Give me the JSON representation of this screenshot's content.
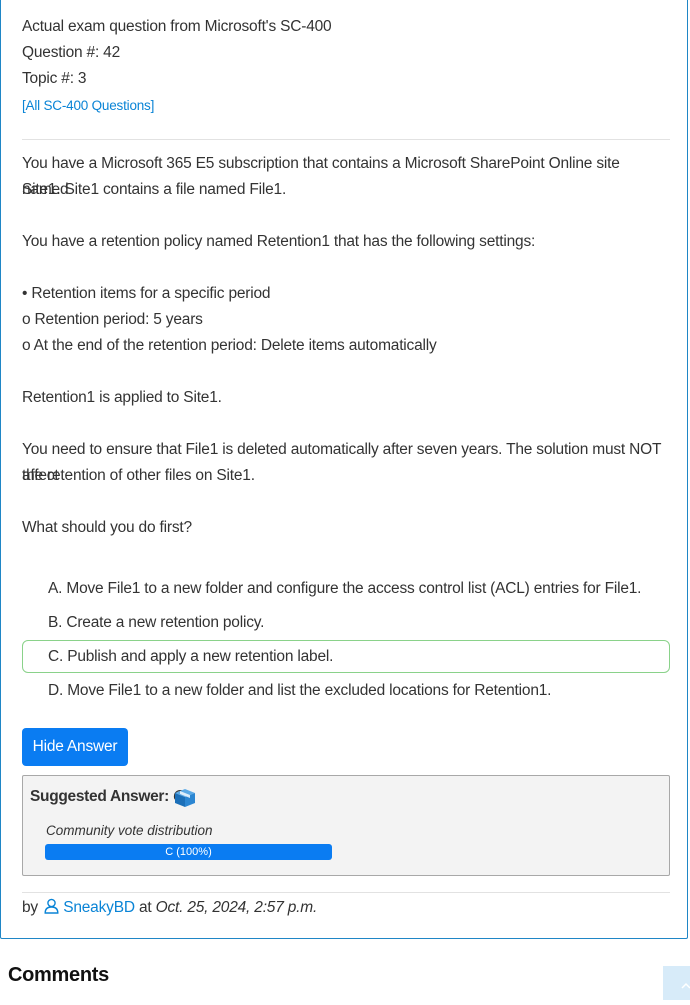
{
  "header": {
    "exam_line": "Actual exam question from Microsoft's SC-400",
    "question_number": "Question #: 42",
    "topic": "Topic #: 3",
    "all_questions_link": "[All SC-400 Questions]"
  },
  "question": {
    "p1a": "You have a Microsoft 365 E5 subscription that contains a Microsoft SharePoint Online site named",
    "p1b": "Site1. Site1 contains a file named File1.",
    "p2": "You have a retention policy named Retention1 that has the following settings:",
    "b1": "• Retention items for a specific period",
    "b2": "o Retention period: 5 years",
    "b3": "o At the end of the retention period: Delete items automatically",
    "p3": "Retention1 is applied to Site1.",
    "p4a": "You need to ensure that File1 is deleted automatically after seven years. The solution must NOT affect",
    "p4b": "the retention of other files on Site1.",
    "p5": "What should you do first?"
  },
  "choices": [
    {
      "text": "A. Move File1 to a new folder and configure the access control list (ACL) entries for File1."
    },
    {
      "text": "B. Create a new retention policy."
    },
    {
      "text": "C. Publish and apply a new retention label."
    },
    {
      "text": "D. Move File1 to a new folder and list the excluded locations for Retention1."
    }
  ],
  "correct_choice_index": 2,
  "hide_answer_button": "Hide Answer",
  "answer": {
    "label": "Suggested Answer:",
    "value": "C",
    "icon": "cube-icon",
    "vote_label": "Community vote distribution",
    "vote_bar_text": "C (100%)",
    "vote_fraction": 1.0
  },
  "byline": {
    "by": "by",
    "user": "SneakyBD",
    "at": "at",
    "date": "Oct. 25, 2024, 2:57 p.m."
  },
  "comments_heading": "Comments",
  "colors": {
    "accent": "#0a7cf2",
    "link": "#0a84d6",
    "correct_border": "#8ad28a",
    "card_border": "#1f86c6"
  }
}
